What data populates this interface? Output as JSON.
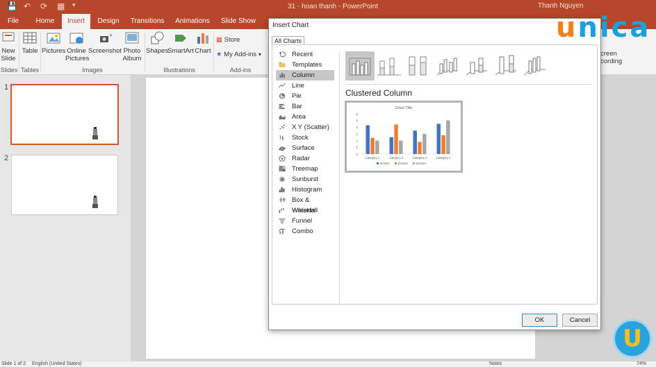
{
  "titlebar": {
    "doc_title": "31 - hoan thanh  -  PowerPoint",
    "user": "Thanh Nguyen"
  },
  "tabs": [
    "File",
    "Home",
    "Insert",
    "Design",
    "Transitions",
    "Animations",
    "Slide Show"
  ],
  "ribbon": {
    "new_slide": "New\nSlide",
    "table": "Table",
    "pictures": "Pictures",
    "online_pictures": "Online\nPictures",
    "screenshot": "Screenshot",
    "photo_album": "Photo\nAlbum",
    "shapes": "Shapes",
    "smartart": "SmartArt",
    "chart": "Chart",
    "store": "Store",
    "my_addins": "My Add-ins",
    "screen_recording": "creen\ncording",
    "share": "Sh",
    "groups": {
      "slides": "Slides",
      "tables": "Tables",
      "images": "Images",
      "illustrations": "Illustrations",
      "addins": "Add-ins"
    }
  },
  "thumbnails": [
    {
      "number": "1"
    },
    {
      "number": "2"
    }
  ],
  "status": {
    "slide_info": "Slide 1 of 2",
    "language": "English (United States)",
    "notes": "Notes",
    "zoom": "74%"
  },
  "dialog": {
    "title": "Insert Chart",
    "tab": "All Charts",
    "chart_types": [
      {
        "label": "Recent",
        "icon": "recent-icon"
      },
      {
        "label": "Templates",
        "icon": "folder-icon"
      },
      {
        "label": "Column",
        "icon": "column-chart-icon"
      },
      {
        "label": "Line",
        "icon": "line-chart-icon"
      },
      {
        "label": "Pie",
        "icon": "pie-chart-icon"
      },
      {
        "label": "Bar",
        "icon": "bar-chart-icon"
      },
      {
        "label": "Area",
        "icon": "area-chart-icon"
      },
      {
        "label": "X Y (Scatter)",
        "icon": "scatter-chart-icon"
      },
      {
        "label": "Stock",
        "icon": "stock-chart-icon"
      },
      {
        "label": "Surface",
        "icon": "surface-chart-icon"
      },
      {
        "label": "Radar",
        "icon": "radar-chart-icon"
      },
      {
        "label": "Treemap",
        "icon": "treemap-chart-icon"
      },
      {
        "label": "Sunburst",
        "icon": "sunburst-chart-icon"
      },
      {
        "label": "Histogram",
        "icon": "histogram-chart-icon"
      },
      {
        "label": "Box & Whisker",
        "icon": "box-whisker-chart-icon"
      },
      {
        "label": "Waterfall",
        "icon": "waterfall-chart-icon"
      },
      {
        "label": "Funnel",
        "icon": "funnel-chart-icon"
      },
      {
        "label": "Combo",
        "icon": "combo-chart-icon"
      }
    ],
    "selected_type": "Column",
    "subtype_title": "Clustered Column",
    "ok": "OK",
    "cancel": "Cancel"
  },
  "chart_data": {
    "type": "bar",
    "title": "Chart Title",
    "categories": [
      "Category 1",
      "Category 2",
      "Category 3",
      "Category 4"
    ],
    "series": [
      {
        "name": "Series1",
        "values": [
          4.3,
          2.5,
          3.5,
          4.5
        ],
        "color": "#4472c4"
      },
      {
        "name": "Series2",
        "values": [
          2.4,
          4.4,
          1.8,
          2.8
        ],
        "color": "#ed7d31"
      },
      {
        "name": "Series3",
        "values": [
          2,
          2,
          3,
          5
        ],
        "color": "#a5a5a5"
      }
    ],
    "ylim": [
      0,
      6
    ],
    "yticks": [
      0,
      1,
      2,
      3,
      4,
      5,
      6
    ],
    "legend": "bottom",
    "grid": false
  },
  "watermark": {
    "brand": "unica",
    "badge": "U"
  },
  "colors": {
    "accent": "#b7472a",
    "selection": "#d35230"
  }
}
